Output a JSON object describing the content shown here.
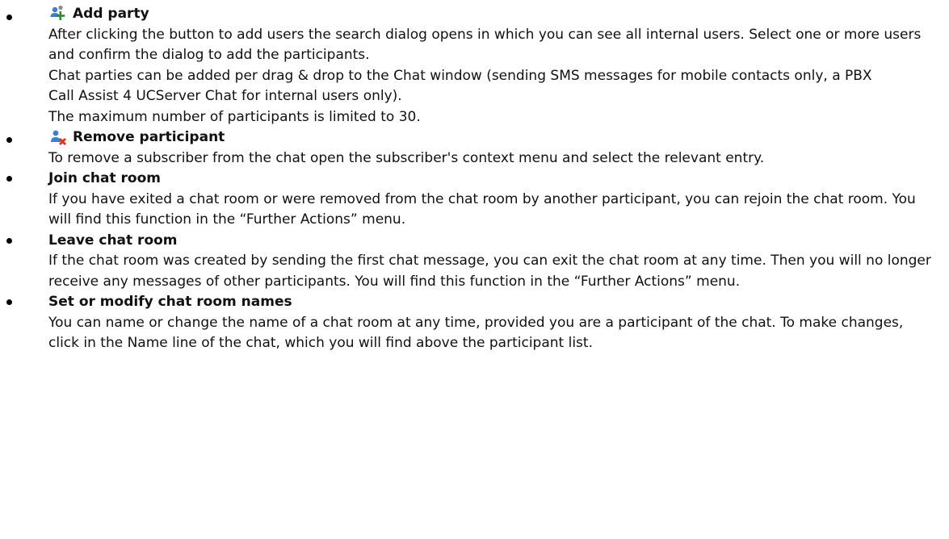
{
  "items": [
    {
      "icon": "add-party-icon",
      "title": "Add party",
      "paragraphs": [
        "After clicking the button to add users the search dialog opens in which you can see all internal users. Select one or more users and confirm the dialog to add the participants.",
        "Chat parties can be added per drag & drop to the Chat window (sending SMS messages for mobile contacts only, a PBX Call Assist 4 UCServer Chat for internal users only).",
        "The maximum number of participants is limited to 30."
      ]
    },
    {
      "icon": "remove-participant-icon",
      "title": "Remove participant",
      "paragraphs": [
        "To remove a subscriber from the chat open the subscriber's context menu and select the relevant entry."
      ]
    },
    {
      "title": "Join chat room",
      "paragraphs": [
        "If you have exited a chat room or were removed from the chat room by another participant, you can rejoin the chat room. You will find this function in the “Further Actions” menu."
      ]
    },
    {
      "title": "Leave chat room",
      "paragraphs": [
        "If the chat room was created by sending the first chat message,  you can exit the chat room at any time. Then you will no longer receive any messages of other participants. You will find this function in the “Further Actions” menu."
      ]
    },
    {
      "title": "Set or modify  chat room names",
      "paragraphs": [
        "You can name or change the name of a chat room at any time, provided you are a participant of the chat. To make changes, click in the Name line of the chat, which you will find above the participant list."
      ]
    }
  ]
}
